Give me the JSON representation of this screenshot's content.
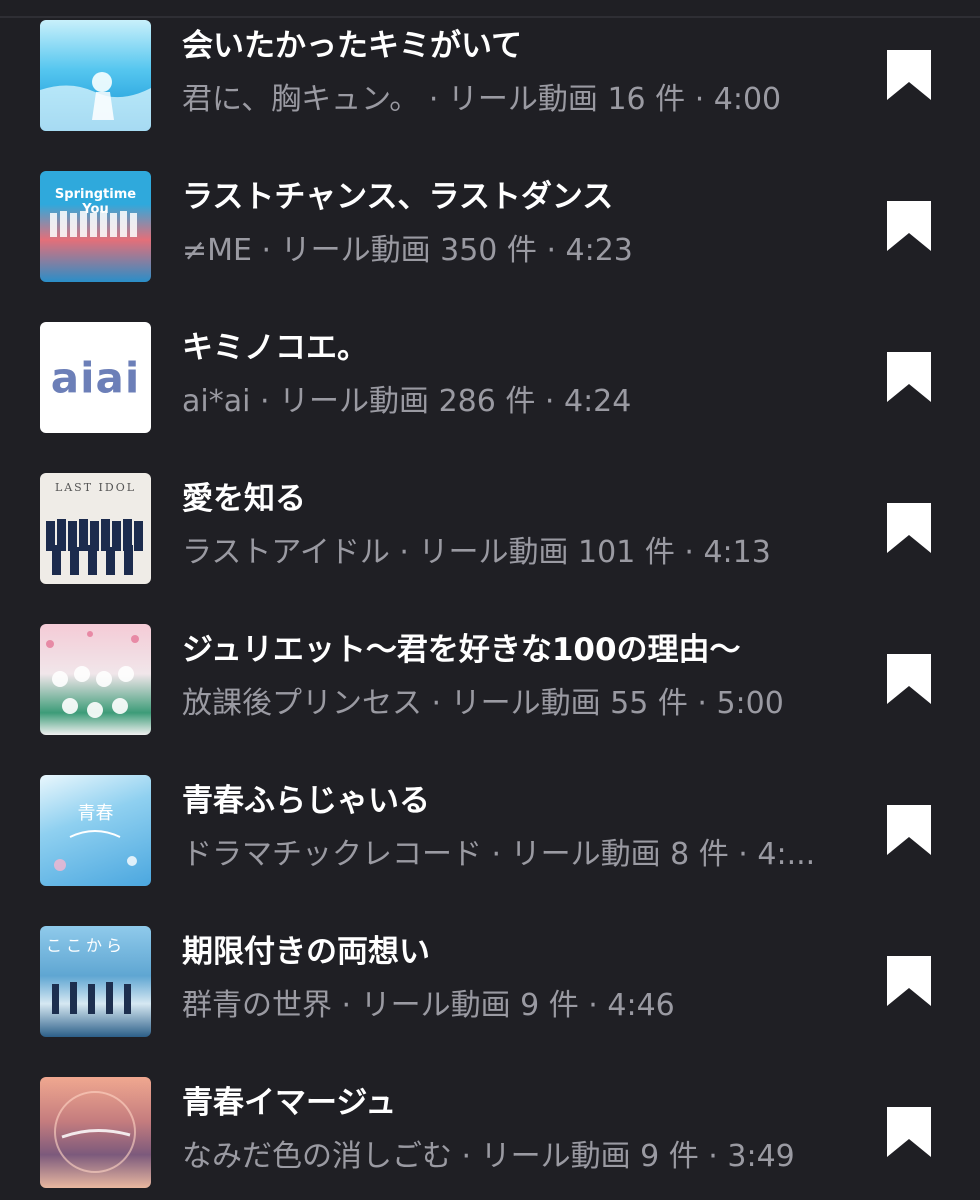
{
  "tracks": [
    {
      "title": "会いたかったキミがいて",
      "artist": "君に、胸キュン。",
      "meta": "君に、胸キュン。 · リール動画 16 件 · 4:00",
      "cover_colors": [
        "#9fe3f3",
        "#1fb4e8",
        "#0a85c8"
      ]
    },
    {
      "title": "ラストチャンス、ラストダンス",
      "artist": "≠ME",
      "meta": "≠ME · リール動画 350 件 · 4:23",
      "cover_colors": [
        "#1aa3d6",
        "#d95d6a",
        "#2b90c8"
      ],
      "cover_text": "Springtime You"
    },
    {
      "title": "キミノコエ。",
      "artist": "ai*ai",
      "meta": "ai*ai · リール動画 286 件 · 4:24",
      "cover_colors": [
        "#ffffff",
        "#ffffff",
        "#ffffff"
      ],
      "cover_text": "aiai"
    },
    {
      "title": "愛を知る",
      "artist": "ラストアイドル",
      "meta": "ラストアイドル · リール動画 101 件 · 4:13",
      "cover_colors": [
        "#f2f0ec",
        "#e9e5df",
        "#1a2a4a"
      ],
      "cover_text": "LAST IDOL"
    },
    {
      "title": "ジュリエット～君を好きな100の理由～",
      "artist": "放課後プリンセス",
      "meta": "放課後プリンセス · リール動画 55 件 · 5:00",
      "cover_colors": [
        "#f4c9d4",
        "#2f8a6a",
        "#f2f2f2"
      ]
    },
    {
      "title": "青春ふらじゃいる",
      "artist": "ドラマチックレコード",
      "meta": "ドラマチックレコード · リール動画 8 件 · 4:...",
      "cover_colors": [
        "#bfe6f7",
        "#4aa8e0",
        "#e9f6fb"
      ],
      "cover_text": "青春"
    },
    {
      "title": "期限付きの両想い",
      "artist": "群青の世界",
      "meta": "群青の世界 · リール動画 9 件 · 4:46",
      "cover_colors": [
        "#8ec8ea",
        "#2e6f9e",
        "#d7e9f3"
      ],
      "cover_text": "ここから"
    },
    {
      "title": "青春イマージュ",
      "artist": "なみだ色の消しごむ",
      "meta": "なみだ色の消しごむ · リール動画 9 件 · 3:49",
      "cover_colors": [
        "#e89a88",
        "#7a5a78",
        "#f2c2a0"
      ]
    }
  ],
  "colors": {
    "background": "#1f1f24",
    "title_text": "#ffffff",
    "meta_text": "#9a9aa2",
    "bookmark_icon": "#ffffff"
  }
}
